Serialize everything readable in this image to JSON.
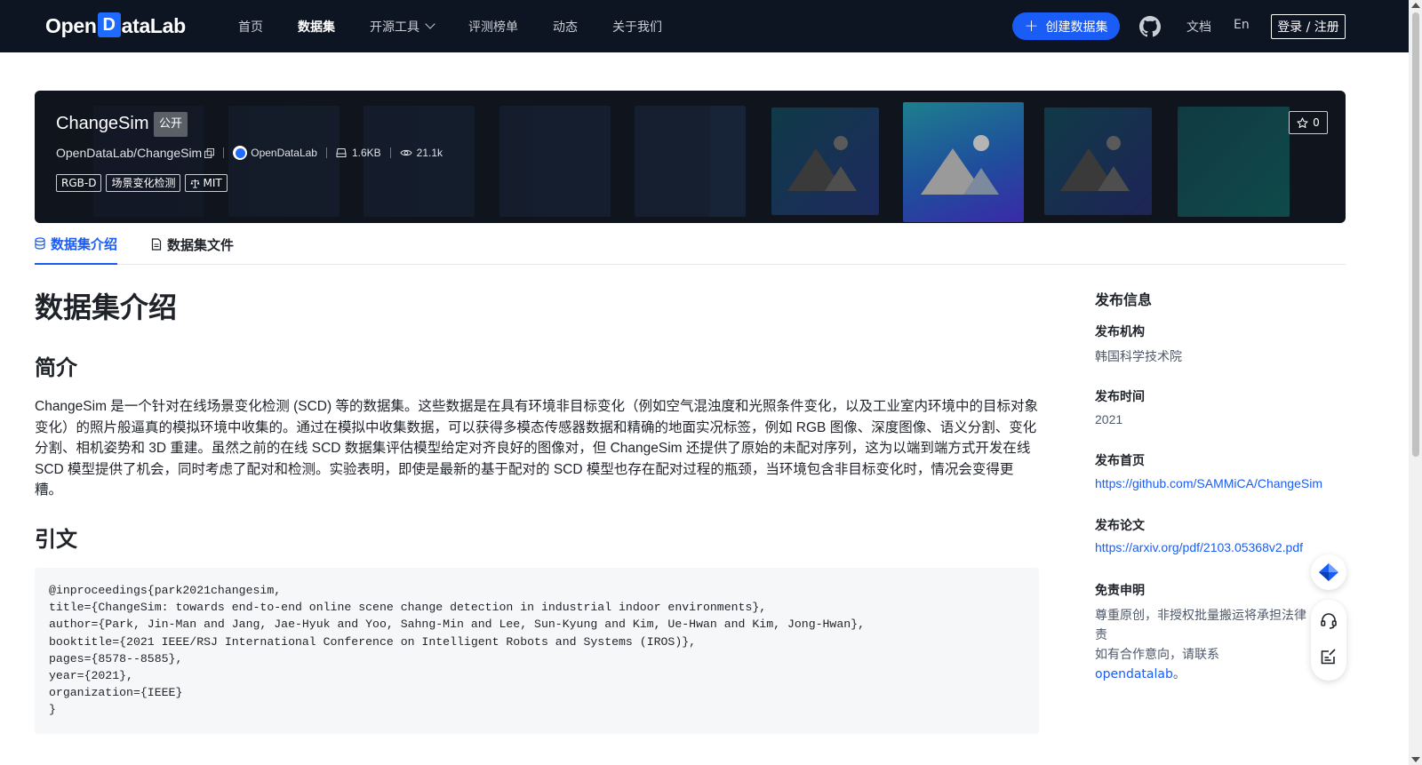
{
  "nav": {
    "logo_pre": "Open",
    "logo_mark": "D",
    "logo_post": "ataLab",
    "links": [
      "首页",
      "数据集",
      "开源工具",
      "评测榜单",
      "动态",
      "关于我们"
    ],
    "create_label": "创建数据集",
    "docs_label": "文档",
    "lang_label": "En",
    "login_label": "登录 / 注册"
  },
  "dataset": {
    "title": "ChangeSim",
    "visibility": "公开",
    "repo": "OpenDataLab/ChangeSim",
    "publisher": "OpenDataLab",
    "size": "1.6KB",
    "views": "21.1k",
    "tags": [
      "RGB-D",
      "场景变化检测"
    ],
    "license": "MIT",
    "stars": "0"
  },
  "tabs": {
    "intro": "数据集介绍",
    "files": "数据集文件"
  },
  "content": {
    "heading": "数据集介绍",
    "summary_heading": "简介",
    "summary": "ChangeSim 是一个针对在线场景变化检测 (SCD) 等的数据集。这些数据是在具有环境非目标变化（例如空气混浊度和光照条件变化，以及工业室内环境中的目标对象变化）的照片般逼真的模拟环境中收集的。通过在模拟中收集数据，可以获得多模态传感器数据和精确的地面实况标签，例如 RGB 图像、深度图像、语义分割、变化分割、相机姿势和 3D 重建。虽然之前的在线 SCD 数据集评估模型给定对齐良好的图像对，但 ChangeSim 还提供了原始的未配对序列，这为以端到端方式开发在线 SCD 模型提供了机会，同时考虑了配对和检测。实验表明，即使是最新的基于配对的 SCD 模型也存在配对过程的瓶颈，当环境包含非目标变化时，情况会变得更糟。",
    "citation_heading": "引文",
    "citation": "@inproceedings{park2021changesim,\ntitle={ChangeSim: towards end-to-end online scene change detection in industrial indoor environments},\nauthor={Park, Jin-Man and Jang, Jae-Hyuk and Yoo, Sahng-Min and Lee, Sun-Kyung and Kim, Ue-Hwan and Kim, Jong-Hwan},\nbooktitle={2021 IEEE/RSJ International Conference on Intelligent Robots and Systems (IROS)},\npages={8578--8585},\nyear={2021},\norganization={IEEE}\n}"
  },
  "sidebar": {
    "title": "发布信息",
    "org_label": "发布机构",
    "org_value": "韩国科学技术院",
    "time_label": "发布时间",
    "time_value": "2021",
    "homepage_label": "发布首页",
    "homepage_url": "https://github.com/SAMMiCA/ChangeSim",
    "paper_label": "发布论文",
    "paper_url": "https://arxiv.org/pdf/2103.05368v2.pdf",
    "disclaimer_label": "免责申明",
    "disclaimer_line1": "尊重原创，非授权批量搬运将承担法律责",
    "disclaimer_line2_pre": "如有合作意向，请联系",
    "disclaimer_link": "opendatalab",
    "disclaimer_line2_post": "。"
  },
  "colors": {
    "nav_bg": "#0d1422",
    "accent": "#1a5cf6",
    "banner_bg": "#10141c"
  },
  "icons": [
    "github-icon",
    "star-icon",
    "database-icon",
    "file-icon",
    "copy-icon",
    "storage-icon",
    "eye-icon",
    "scale-icon",
    "plus-icon",
    "chevron-down-icon",
    "back-to-top-icon",
    "headset-icon",
    "feedback-icon"
  ]
}
